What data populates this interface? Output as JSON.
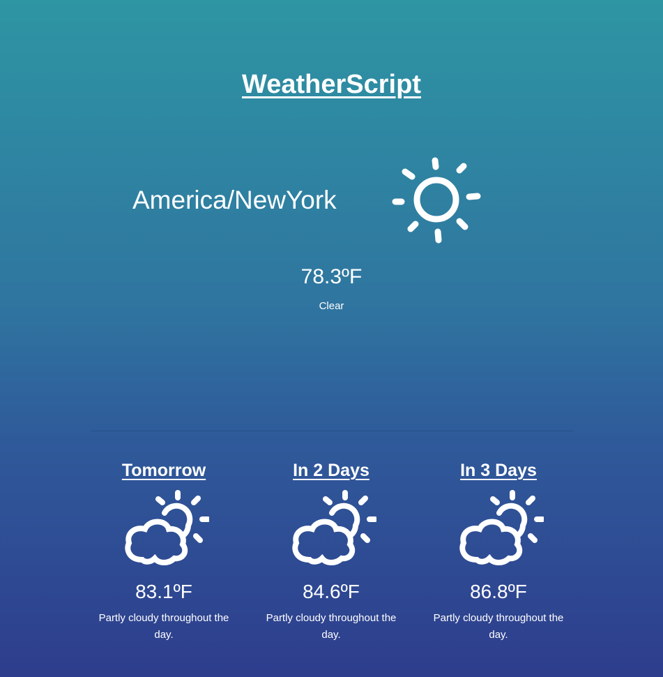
{
  "app": {
    "title": "WeatherScript"
  },
  "current": {
    "location": "America/NewYork",
    "temperature": "78.3ºF",
    "summary": "Clear",
    "icon": "sun-icon"
  },
  "forecast": [
    {
      "label": "Tomorrow",
      "temperature": "83.1ºF",
      "summary": "Partly cloudy throughout the day.",
      "icon": "partly-cloudy-icon"
    },
    {
      "label": "In 2 Days",
      "temperature": "84.6ºF",
      "summary": "Partly cloudy throughout the day.",
      "icon": "partly-cloudy-icon"
    },
    {
      "label": "In 3 Days",
      "temperature": "86.8ºF",
      "summary": "Partly cloudy throughout the day.",
      "icon": "partly-cloudy-icon"
    }
  ],
  "colors": {
    "gradient_top": "#2e95a3",
    "gradient_bottom": "#2e3d8d",
    "text": "#ffffff"
  }
}
